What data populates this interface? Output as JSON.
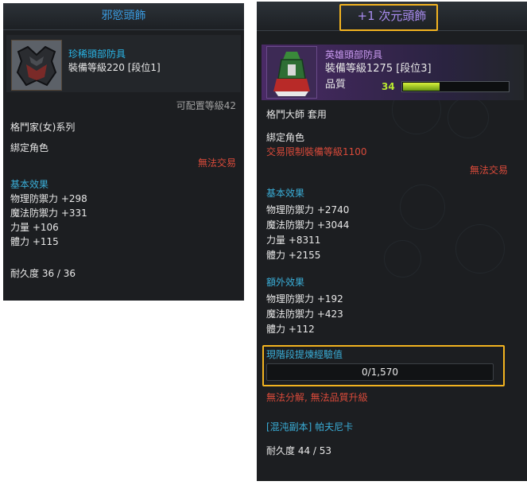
{
  "left": {
    "title": "邪慾頭飾",
    "item_name": "珍稀頭部防具",
    "item_level": "裝備等級220 [段位1]",
    "equip_level": "可配置等級42",
    "class_series": "格鬥家(女)系列",
    "bind": "綁定角色",
    "trade": "無法交易",
    "basic_title": "基本效果",
    "stats": [
      "物理防禦力 +298",
      "魔法防禦力 +331",
      "力量 +106",
      "體力 +115"
    ],
    "durability": "耐久度 36 / 36"
  },
  "right": {
    "title": "+1 次元頭飾",
    "item_name": "英雄頭部防具",
    "item_level": "裝備等級1275 [段位3]",
    "quality_label": "品質",
    "quality_value": "34",
    "quality_fraction": 0.34,
    "set_name": "格鬥大師 套用",
    "bind": "綁定角色",
    "trade_limit": "交易限制裝備等級1100",
    "trade": "無法交易",
    "basic_title": "基本效果",
    "stats": [
      "物理防禦力 +2740",
      "魔法防禦力 +3044",
      "力量 +8311",
      "體力 +2155"
    ],
    "extra_title": "額外效果",
    "extra_stats": [
      "物理防禦力 +192",
      "魔法防禦力 +423",
      "體力 +112"
    ],
    "exp_title": "現階段提煉經驗值",
    "exp_value": "0/1,570",
    "restrictions": "無法分解, 無法品質升級",
    "source": "[混沌副本] 帕夫尼卡",
    "durability": "耐久度 44 / 53"
  },
  "colors": {
    "panel_bg": "#1c1e21",
    "item_blue": "#29b6e8",
    "item_purple_bg": "#4a2a66",
    "title_purple": "#a98cf0",
    "warning_red": "#d94a3a",
    "quality_green": "#b8e830",
    "highlight_orange": "#f2b320"
  }
}
